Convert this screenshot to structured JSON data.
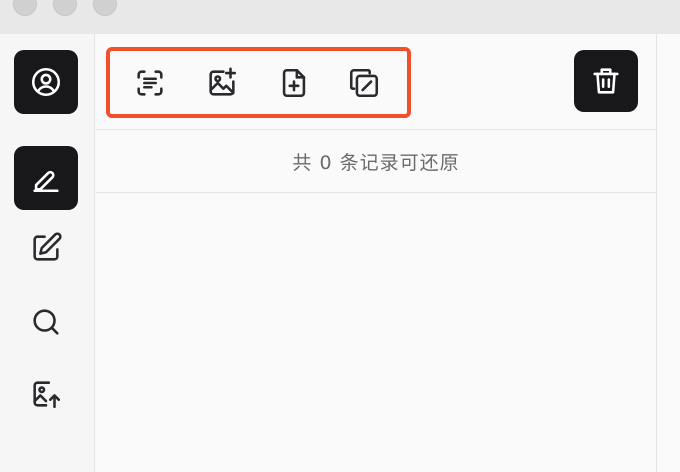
{
  "window": {
    "traffic_lights": [
      "close",
      "minimize",
      "zoom"
    ]
  },
  "sidebar": {
    "items": [
      {
        "icon": "user-circle-icon",
        "selected": true
      },
      {
        "icon": "pen-signature-icon",
        "selected": true
      },
      {
        "icon": "edit-icon",
        "selected": false
      },
      {
        "icon": "search-icon",
        "selected": false
      },
      {
        "icon": "image-upload-icon",
        "selected": false
      }
    ]
  },
  "toolbar": {
    "tools": [
      {
        "icon": "scan-text-icon"
      },
      {
        "icon": "image-add-icon"
      },
      {
        "icon": "file-add-icon"
      },
      {
        "icon": "copy-edit-icon"
      }
    ],
    "highlight_color": "#f0502a",
    "delete_icon": "trash-icon"
  },
  "status": {
    "text": "共 0 条记录可还原"
  },
  "colors": {
    "dark_button": "#18181b",
    "background": "#fafafa",
    "titlebar": "#e8e8e8"
  }
}
